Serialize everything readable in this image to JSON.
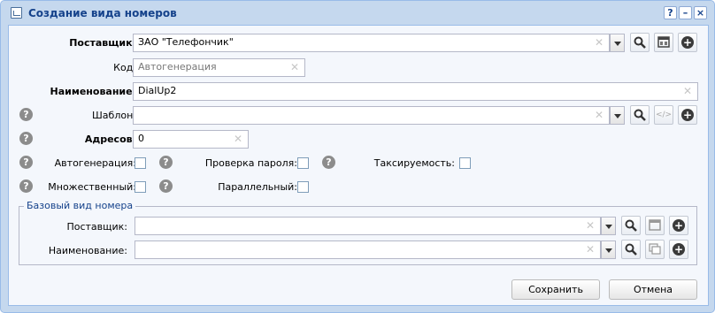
{
  "window": {
    "title": "Создание вида номеров",
    "tools": {
      "help": "?",
      "minimize": "–",
      "close": "×"
    }
  },
  "form": {
    "supplier": {
      "label": "Поставщик:",
      "value": "ЗАО \"Телефончик\""
    },
    "code": {
      "label": "Код:",
      "placeholder": "Автогенерация"
    },
    "name": {
      "label": "Наименование:",
      "value": "DialUp2"
    },
    "template": {
      "label": "Шаблон:",
      "value": ""
    },
    "addresses": {
      "label": "Адресов:",
      "value": "0"
    },
    "autogen": {
      "label": "Автогенерация:",
      "checked": false
    },
    "password_check": {
      "label": "Проверка пароля:",
      "checked": false
    },
    "tariffable": {
      "label": "Таксируемость:",
      "checked": false
    },
    "multiple": {
      "label": "Множественный:",
      "checked": false
    },
    "parallel": {
      "label": "Параллельный:",
      "checked": false
    }
  },
  "base_group": {
    "legend": "Базовый вид номера",
    "supplier": {
      "label": "Поставщик:",
      "value": ""
    },
    "name": {
      "label": "Наименование:",
      "value": ""
    }
  },
  "icons": {
    "help": "?",
    "clear": "✕",
    "search": "🔍",
    "add": "+",
    "code": "</>"
  },
  "actions": {
    "save": "Сохранить",
    "cancel": "Отмена"
  }
}
